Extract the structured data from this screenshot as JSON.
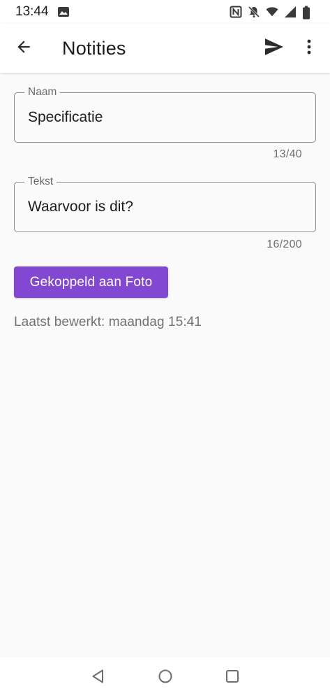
{
  "status_bar": {
    "time": "13:44",
    "icons": [
      "image-icon",
      "nfc-icon",
      "bell-off-icon",
      "wifi-icon",
      "signal-icon",
      "battery-icon"
    ]
  },
  "app_bar": {
    "title": "Notities",
    "back_icon": "arrow-back-icon",
    "send_icon": "send-icon",
    "more_icon": "more-vert-icon"
  },
  "form": {
    "name_field": {
      "label": "Naam",
      "value": "Specificatie",
      "counter": "13/40"
    },
    "text_field": {
      "label": "Tekst",
      "value": "Waarvoor is dit?",
      "counter": "16/200"
    }
  },
  "link_button": {
    "label": "Gekoppeld aan Foto",
    "color": "#8348d1"
  },
  "last_edited": "Laatst bewerkt: maandag 15:41",
  "nav_bar": {
    "icons": [
      "back-triangle-icon",
      "home-circle-icon",
      "recents-square-icon"
    ]
  }
}
